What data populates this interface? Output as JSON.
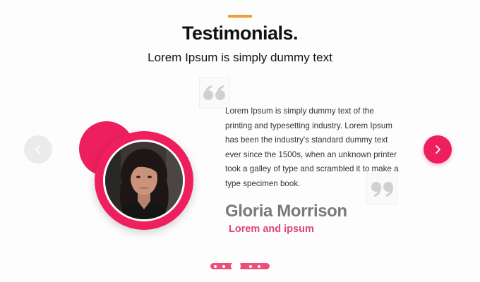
{
  "section": {
    "title": "Testimonials.",
    "subtitle": "Lorem Ipsum is simply dummy text",
    "accent_color": "#e8a13c"
  },
  "carousel": {
    "prev_icon": "chevron-left-icon",
    "next_icon": "chevron-right-icon",
    "brand_color": "#ee1f5d",
    "slide_count": 5,
    "active_slide": 2
  },
  "testimonial": {
    "quote": "Lorem Ipsum is simply dummy text of the printing and typesetting industry. Lorem Ipsum has been the industry's standard dummy text ever since the 1500s, when an unknown printer took a galley of type and scrambled it to make a type specimen book.",
    "name": "Gloria Morrison",
    "role": "Lorem and ipsum",
    "open_quote_icon": "quote-open-icon",
    "close_quote_icon": "quote-close-icon",
    "avatar_icon": "avatar"
  }
}
